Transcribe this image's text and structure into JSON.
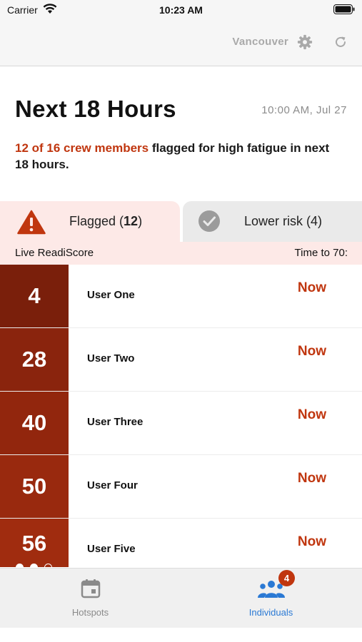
{
  "status_bar": {
    "carrier": "Carrier",
    "time": "10:23 AM"
  },
  "header": {
    "location": "Vancouver",
    "icons": [
      "gear-icon",
      "refresh-icon"
    ]
  },
  "title_section": {
    "title": "Next 18 Hours",
    "time": "10:00 AM, Jul 27",
    "summary_highlight": "12 of 16 crew members",
    "summary_rest": " flagged for high fatigue in next 18 hours."
  },
  "tabs": {
    "flagged_label": "Flagged (",
    "flagged_count": "12",
    "flagged_close": ")",
    "lower_label": "Lower risk (4)"
  },
  "list_header": {
    "left": "Live ReadiScore",
    "right": "Time to 70:"
  },
  "crew": [
    {
      "score": "4",
      "name": "User One",
      "time": "Now",
      "color": "#7a1f0b"
    },
    {
      "score": "28",
      "name": "User Two",
      "time": "Now",
      "color": "#8a240d"
    },
    {
      "score": "40",
      "name": "User Three",
      "time": "Now",
      "color": "#92260d"
    },
    {
      "score": "50",
      "name": "User Four",
      "time": "Now",
      "color": "#99290e"
    },
    {
      "score": "56",
      "name": "User Five",
      "time": "Now",
      "color": "#a02c0f"
    }
  ],
  "page_dots": {
    "total": 3,
    "active": 2
  },
  "tabbar": {
    "hotspots_label": "Hotspots",
    "individuals_label": "Individuals",
    "individuals_badge": "4",
    "active_color": "#2a79d4",
    "inactive_color": "#8a8a8a"
  },
  "colors": {
    "accent": "#c0360f",
    "flagged_bg": "#fde9e7"
  }
}
